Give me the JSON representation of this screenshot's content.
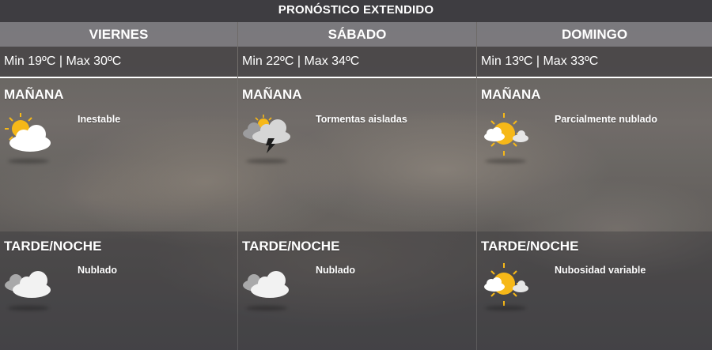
{
  "title": "PRONÓSTICO EXTENDIDO",
  "days": [
    {
      "name": "VIERNES",
      "minmax": "Min 19ºC | Max 30ºC",
      "morning": {
        "label": "MAÑANA",
        "condition": "Inestable",
        "icon": "sun-cloud-icon"
      },
      "evening": {
        "label": "TARDE/NOCHE",
        "condition": "Nublado",
        "icon": "clouds-icon"
      }
    },
    {
      "name": "SÁBADO",
      "minmax": "Min 22ºC | Max 34ºC",
      "morning": {
        "label": "MAÑANA",
        "condition": "Tormentas aisladas",
        "icon": "thunderstorm-icon"
      },
      "evening": {
        "label": "TARDE/NOCHE",
        "condition": "Nublado",
        "icon": "clouds-icon"
      }
    },
    {
      "name": "DOMINGO",
      "minmax": "Min 13ºC | Max 33ºC",
      "morning": {
        "label": "MAÑANA",
        "condition": "Parcialmente nublado",
        "icon": "partly-cloudy-icon"
      },
      "evening": {
        "label": "TARDE/NOCHE",
        "condition": "Nubosidad variable",
        "icon": "partly-cloudy-icon"
      }
    }
  ],
  "colors": {
    "header": "#3e3d41",
    "day_bar": "#7d7c80",
    "sun": "#f6b818",
    "cloud": "#ffffff"
  }
}
